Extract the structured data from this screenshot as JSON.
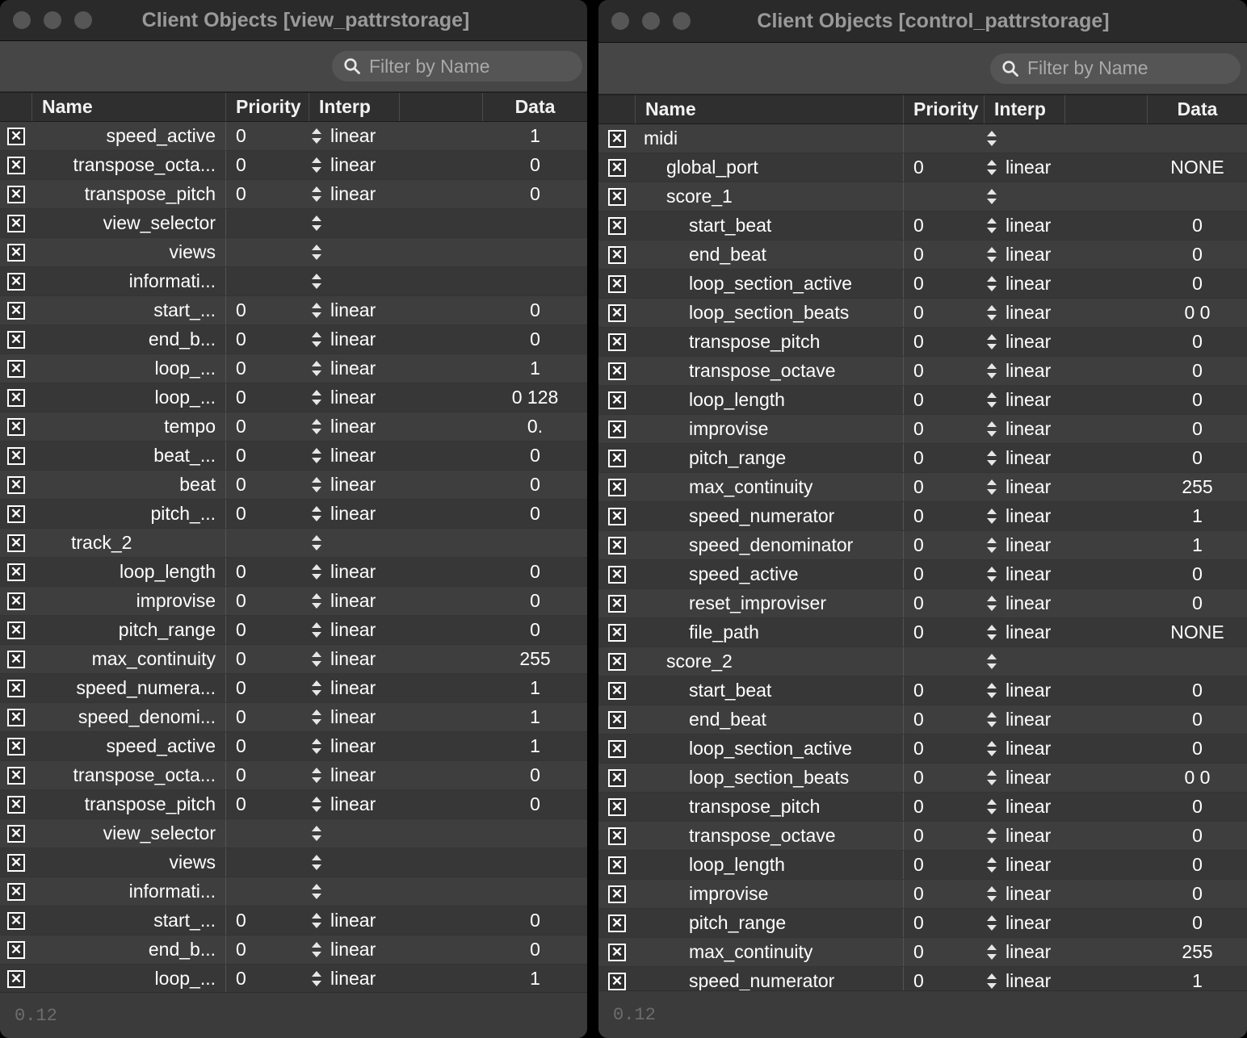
{
  "windows": [
    {
      "key": "left",
      "title": "Client Objects [view_pattrstorage]",
      "traffic_lights": [
        "close-button",
        "minimize-button",
        "zoom-button"
      ],
      "search": {
        "placeholder": "Filter by Name",
        "value": "",
        "icon": "search-icon"
      },
      "columns": [
        "Name",
        "Priority",
        "Interp",
        "",
        "Data"
      ],
      "footer": "0.12",
      "name_align": "right",
      "rows": [
        {
          "name": "speed_active",
          "indent": 3,
          "priority": "0",
          "interp": "linear",
          "data": "1"
        },
        {
          "name": "transpose_octa...",
          "indent": 3,
          "priority": "0",
          "interp": "linear",
          "data": "0"
        },
        {
          "name": "transpose_pitch",
          "indent": 3,
          "priority": "0",
          "interp": "linear",
          "data": "0"
        },
        {
          "name": "view_selector",
          "indent": 3,
          "priority": "",
          "interp": "",
          "data": ""
        },
        {
          "name": "views",
          "indent": 4,
          "priority": "",
          "interp": "",
          "data": ""
        },
        {
          "name": "informati...",
          "indent": 5,
          "priority": "",
          "interp": "",
          "data": ""
        },
        {
          "name": "start_...",
          "indent": 6,
          "priority": "0",
          "interp": "linear",
          "data": "0"
        },
        {
          "name": "end_b...",
          "indent": 6,
          "priority": "0",
          "interp": "linear",
          "data": "0"
        },
        {
          "name": "loop_...",
          "indent": 6,
          "priority": "0",
          "interp": "linear",
          "data": "1"
        },
        {
          "name": "loop_...",
          "indent": 6,
          "priority": "0",
          "interp": "linear",
          "data": "0 128"
        },
        {
          "name": "tempo",
          "indent": 6,
          "priority": "0",
          "interp": "linear",
          "data": "0."
        },
        {
          "name": "beat_...",
          "indent": 6,
          "priority": "0",
          "interp": "linear",
          "data": "0"
        },
        {
          "name": "beat",
          "indent": 6,
          "priority": "0",
          "interp": "linear",
          "data": "0"
        },
        {
          "name": "pitch_...",
          "indent": 6,
          "priority": "0",
          "interp": "linear",
          "data": "0"
        },
        {
          "name": "track_2",
          "indent": 1,
          "priority": "",
          "interp": "",
          "data": ""
        },
        {
          "name": "loop_length",
          "indent": 2,
          "priority": "0",
          "interp": "linear",
          "data": "0"
        },
        {
          "name": "improvise",
          "indent": 2,
          "priority": "0",
          "interp": "linear",
          "data": "0"
        },
        {
          "name": "pitch_range",
          "indent": 2,
          "priority": "0",
          "interp": "linear",
          "data": "0"
        },
        {
          "name": "max_continuity",
          "indent": 2,
          "priority": "0",
          "interp": "linear",
          "data": "255"
        },
        {
          "name": "speed_numera...",
          "indent": 2,
          "priority": "0",
          "interp": "linear",
          "data": "1"
        },
        {
          "name": "speed_denomi...",
          "indent": 2,
          "priority": "0",
          "interp": "linear",
          "data": "1"
        },
        {
          "name": "speed_active",
          "indent": 2,
          "priority": "0",
          "interp": "linear",
          "data": "1"
        },
        {
          "name": "transpose_octa...",
          "indent": 2,
          "priority": "0",
          "interp": "linear",
          "data": "0"
        },
        {
          "name": "transpose_pitch",
          "indent": 2,
          "priority": "0",
          "interp": "linear",
          "data": "0"
        },
        {
          "name": "view_selector",
          "indent": 3,
          "priority": "",
          "interp": "",
          "data": ""
        },
        {
          "name": "views",
          "indent": 4,
          "priority": "",
          "interp": "",
          "data": ""
        },
        {
          "name": "informati...",
          "indent": 5,
          "priority": "",
          "interp": "",
          "data": ""
        },
        {
          "name": "start_...",
          "indent": 6,
          "priority": "0",
          "interp": "linear",
          "data": "0"
        },
        {
          "name": "end_b...",
          "indent": 6,
          "priority": "0",
          "interp": "linear",
          "data": "0"
        },
        {
          "name": "loop_...",
          "indent": 6,
          "priority": "0",
          "interp": "linear",
          "data": "1"
        }
      ]
    },
    {
      "key": "right",
      "title": "Client Objects [control_pattrstorage]",
      "traffic_lights": [
        "close-button",
        "minimize-button",
        "zoom-button"
      ],
      "search": {
        "placeholder": "Filter by Name",
        "value": "",
        "icon": "search-icon"
      },
      "columns": [
        "Name",
        "Priority",
        "Interp",
        "",
        "Data"
      ],
      "footer": "0.12",
      "name_align": "left",
      "rows": [
        {
          "name": "midi",
          "indent": 0,
          "priority": "",
          "interp": "",
          "data": ""
        },
        {
          "name": "global_port",
          "indent": 1,
          "priority": "0",
          "interp": "linear",
          "data": "NONE"
        },
        {
          "name": "score_1",
          "indent": 1,
          "priority": "",
          "interp": "",
          "data": ""
        },
        {
          "name": "start_beat",
          "indent": 2,
          "priority": "0",
          "interp": "linear",
          "data": "0"
        },
        {
          "name": "end_beat",
          "indent": 2,
          "priority": "0",
          "interp": "linear",
          "data": "0"
        },
        {
          "name": "loop_section_active",
          "indent": 2,
          "priority": "0",
          "interp": "linear",
          "data": "0"
        },
        {
          "name": "loop_section_beats",
          "indent": 2,
          "priority": "0",
          "interp": "linear",
          "data": "0 0"
        },
        {
          "name": "transpose_pitch",
          "indent": 2,
          "priority": "0",
          "interp": "linear",
          "data": "0"
        },
        {
          "name": "transpose_octave",
          "indent": 2,
          "priority": "0",
          "interp": "linear",
          "data": "0"
        },
        {
          "name": "loop_length",
          "indent": 2,
          "priority": "0",
          "interp": "linear",
          "data": "0"
        },
        {
          "name": "improvise",
          "indent": 2,
          "priority": "0",
          "interp": "linear",
          "data": "0"
        },
        {
          "name": "pitch_range",
          "indent": 2,
          "priority": "0",
          "interp": "linear",
          "data": "0"
        },
        {
          "name": "max_continuity",
          "indent": 2,
          "priority": "0",
          "interp": "linear",
          "data": "255"
        },
        {
          "name": "speed_numerator",
          "indent": 2,
          "priority": "0",
          "interp": "linear",
          "data": "1"
        },
        {
          "name": "speed_denominator",
          "indent": 2,
          "priority": "0",
          "interp": "linear",
          "data": "1"
        },
        {
          "name": "speed_active",
          "indent": 2,
          "priority": "0",
          "interp": "linear",
          "data": "0"
        },
        {
          "name": "reset_improviser",
          "indent": 2,
          "priority": "0",
          "interp": "linear",
          "data": "0"
        },
        {
          "name": "file_path",
          "indent": 2,
          "priority": "0",
          "interp": "linear",
          "data": "NONE"
        },
        {
          "name": "score_2",
          "indent": 1,
          "priority": "",
          "interp": "",
          "data": ""
        },
        {
          "name": "start_beat",
          "indent": 2,
          "priority": "0",
          "interp": "linear",
          "data": "0"
        },
        {
          "name": "end_beat",
          "indent": 2,
          "priority": "0",
          "interp": "linear",
          "data": "0"
        },
        {
          "name": "loop_section_active",
          "indent": 2,
          "priority": "0",
          "interp": "linear",
          "data": "0"
        },
        {
          "name": "loop_section_beats",
          "indent": 2,
          "priority": "0",
          "interp": "linear",
          "data": "0 0"
        },
        {
          "name": "transpose_pitch",
          "indent": 2,
          "priority": "0",
          "interp": "linear",
          "data": "0"
        },
        {
          "name": "transpose_octave",
          "indent": 2,
          "priority": "0",
          "interp": "linear",
          "data": "0"
        },
        {
          "name": "loop_length",
          "indent": 2,
          "priority": "0",
          "interp": "linear",
          "data": "0"
        },
        {
          "name": "improvise",
          "indent": 2,
          "priority": "0",
          "interp": "linear",
          "data": "0"
        },
        {
          "name": "pitch_range",
          "indent": 2,
          "priority": "0",
          "interp": "linear",
          "data": "0"
        },
        {
          "name": "max_continuity",
          "indent": 2,
          "priority": "0",
          "interp": "linear",
          "data": "255"
        },
        {
          "name": "speed_numerator",
          "indent": 2,
          "priority": "0",
          "interp": "linear",
          "data": "1"
        }
      ]
    }
  ],
  "checkbox_glyph": "✕",
  "colors": {
    "window_bg": "#3b3b3b",
    "titlebar_bg": "#2a2a2a",
    "header_bg": "#2f2f2f",
    "row_odd": "#3e3e3e",
    "row_even": "#373737",
    "text": "#ffffff",
    "muted_text": "#9a9a9a",
    "desktop_bg": "#000000"
  }
}
